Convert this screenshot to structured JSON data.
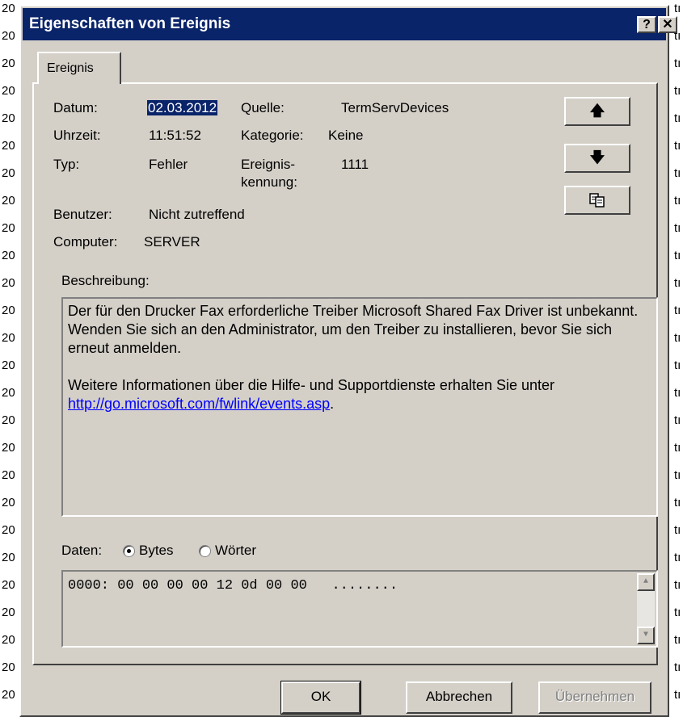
{
  "background": {
    "left_fragment": "20",
    "right_fragment": "tı"
  },
  "dialog": {
    "title": "Eigenschaften von Ereignis",
    "help_label": "?",
    "close_label": "✕"
  },
  "tab": {
    "label": "Ereignis"
  },
  "fields": {
    "datum_label": "Datum:",
    "datum_value": "02.03.2012",
    "uhrzeit_label": "Uhrzeit:",
    "uhrzeit_value": "11:51:52",
    "typ_label": "Typ:",
    "typ_value": "Fehler",
    "quelle_label": "Quelle:",
    "quelle_value": "TermServDevices",
    "kategorie_label": "Kategorie:",
    "kategorie_value": "Keine",
    "ereignis_label_1": "Ereignis-",
    "ereignis_label_2": "kennung:",
    "ereignis_value": "1111",
    "benutzer_label": "Benutzer:",
    "benutzer_value": "Nicht zutreffend",
    "computer_label": "Computer:",
    "computer_value": "SERVER"
  },
  "side_buttons": {
    "up_icon": "arrow-up-icon",
    "down_icon": "arrow-down-icon",
    "copy_icon": "copy-icon"
  },
  "description": {
    "label": "Beschreibung:",
    "paragraph1": "Der für den Drucker Fax erforderliche Treiber Microsoft Shared Fax Driver ist unbekannt. Wenden Sie sich an den Administrator, um den Treiber zu installieren, bevor Sie sich erneut anmelden.",
    "paragraph2_prefix": "Weitere Informationen über die Hilfe- und Supportdienste erhalten Sie unter ",
    "link": "http://go.microsoft.com/fwlink/events.asp",
    "paragraph2_suffix": "."
  },
  "data_section": {
    "label": "Daten:",
    "bytes_label": "Bytes",
    "words_label": "Wörter",
    "selected": "Bytes",
    "line": "0000: 00 00 00 00 12 0d 00 00   ........"
  },
  "buttons": {
    "ok": "OK",
    "cancel": "Abbrechen",
    "apply": "Übernehmen"
  }
}
